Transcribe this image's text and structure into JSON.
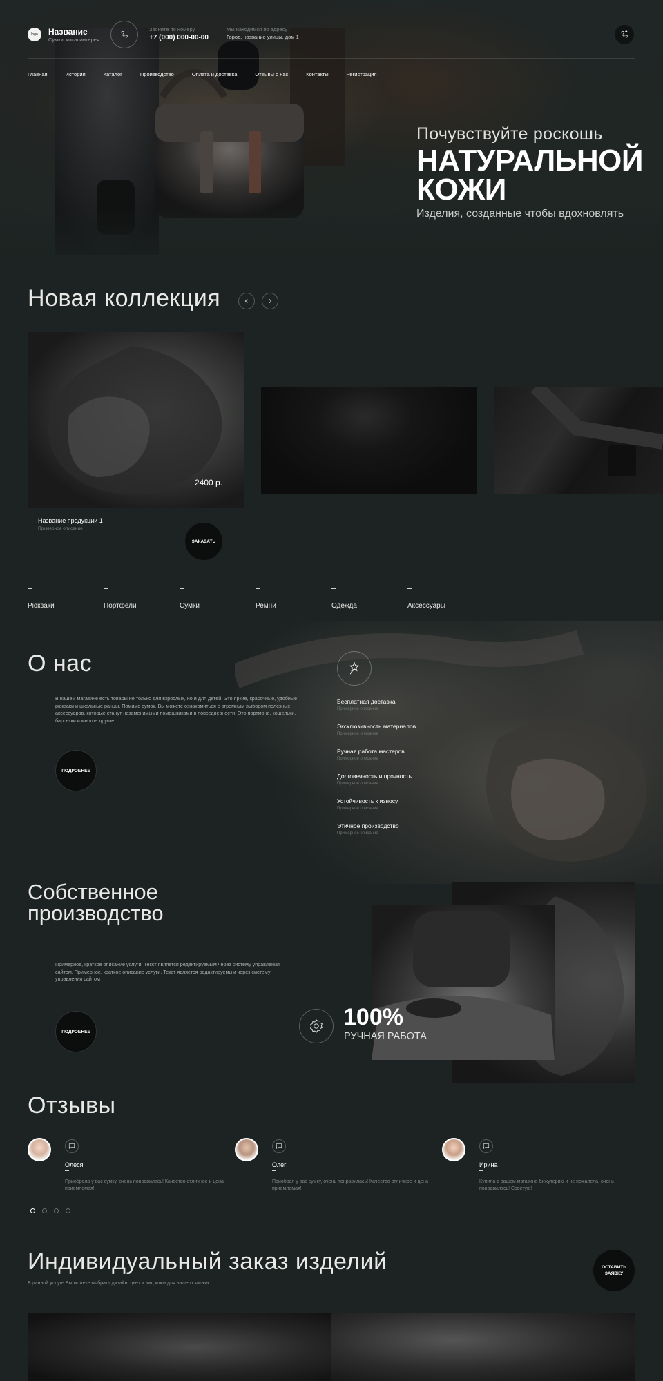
{
  "header": {
    "logo_text": "logo",
    "brand_name": "Название",
    "brand_sub": "Сумки, косалантерея",
    "phone_label": "Звоните по номеру",
    "phone": "+7 (000) 000-00-00",
    "address_label": "Мы находимся по адресу",
    "address": "Город, название улицы, дом 1"
  },
  "nav": [
    "Главная",
    "История",
    "Каталог",
    "Производство",
    "Оплата и доставка",
    "Отзывы о нас",
    "Контакты",
    "Регистрация"
  ],
  "hero": {
    "line1": "Почувствуйте роскошь",
    "line2": "НАТУРАЛЬНОЙ",
    "line3": "КОЖИ",
    "line4": "Изделия, созданные чтобы вдохновлять"
  },
  "collection": {
    "title": "Новая коллекция",
    "price": "2400 р.",
    "product_name": "Название продукции 1",
    "product_desc": "Примерное описание",
    "order_label": "ЗАКАЗАТЬ"
  },
  "categories": [
    "Рюкзаки",
    "Портфели",
    "Сумки",
    "Ремни",
    "Одежда",
    "Аксессуары"
  ],
  "about": {
    "title": "О нас",
    "text": "В нашем магазине есть товары не только для взрослых, но и для детей. Это яркие, красочные, удобные рюкзаки и школьные ранцы. Помимо сумок, Вы можете ознакомиться с огромным выбором полезных аксессуаров, которые станут незаменимыми помощниками в повседневности. Это портмоне, кошельки, барсетки и многое другое.",
    "more_label": "ПОДРОБНЕЕ",
    "features": [
      {
        "title": "Бесплатная доставка",
        "desc": "Примерное описание"
      },
      {
        "title": "Эксклюзивность материалов",
        "desc": "Примерное описание"
      },
      {
        "title": "Ручная работа мастеров",
        "desc": "Примерное описание"
      },
      {
        "title": "Долговечность и прочность",
        "desc": "Примерное описание"
      },
      {
        "title": "Устойчивость к износу",
        "desc": "Примерное описание"
      },
      {
        "title": "Этичное производство",
        "desc": "Примерное описание"
      }
    ]
  },
  "production": {
    "title_line1": "Собственное",
    "title_line2": "производство",
    "text": "Примерное, краткое описание услуги. Текст является редактируемым через систему управления сайтом. Примерное, краткое описание услуги. Текст является редактируемым через систему управления сайтом",
    "more_label": "ПОДРОБНЕЕ",
    "percent": "100%",
    "percent_label": "РУЧНАЯ РАБОТА"
  },
  "reviews": {
    "title": "Отзывы",
    "items": [
      {
        "name": "Олеся",
        "text": "Приобрела у вас сумку, очень понравилась! Качество отличное и цена приемлемая!"
      },
      {
        "name": "Олег",
        "text": "Приобрел у вас сумку, очень понравилась! Качество отличное и цена приемлемая!"
      },
      {
        "name": "Ирина",
        "text": "Купила в вашем магазине бижутерию и не пожалела, очень понравилась! Советую!"
      }
    ],
    "pages": 4,
    "active_page": 1
  },
  "custom": {
    "title": "Индивидуальный заказ изделий",
    "subtitle": "В данной услуге Вы можете выбрать дизайн, цвет и вид кожи для вашего заказа",
    "button_line1": "ОСТАВИТЬ",
    "button_line2": "ЗАЯВКУ"
  },
  "icons": {
    "phone": "phone-icon",
    "callback": "phone-callback-icon",
    "prev": "chevron-left-icon",
    "next": "chevron-right-icon",
    "feature": "leaf-star-icon",
    "badge": "badge-icon",
    "quote": "speech-bubble-icon"
  }
}
